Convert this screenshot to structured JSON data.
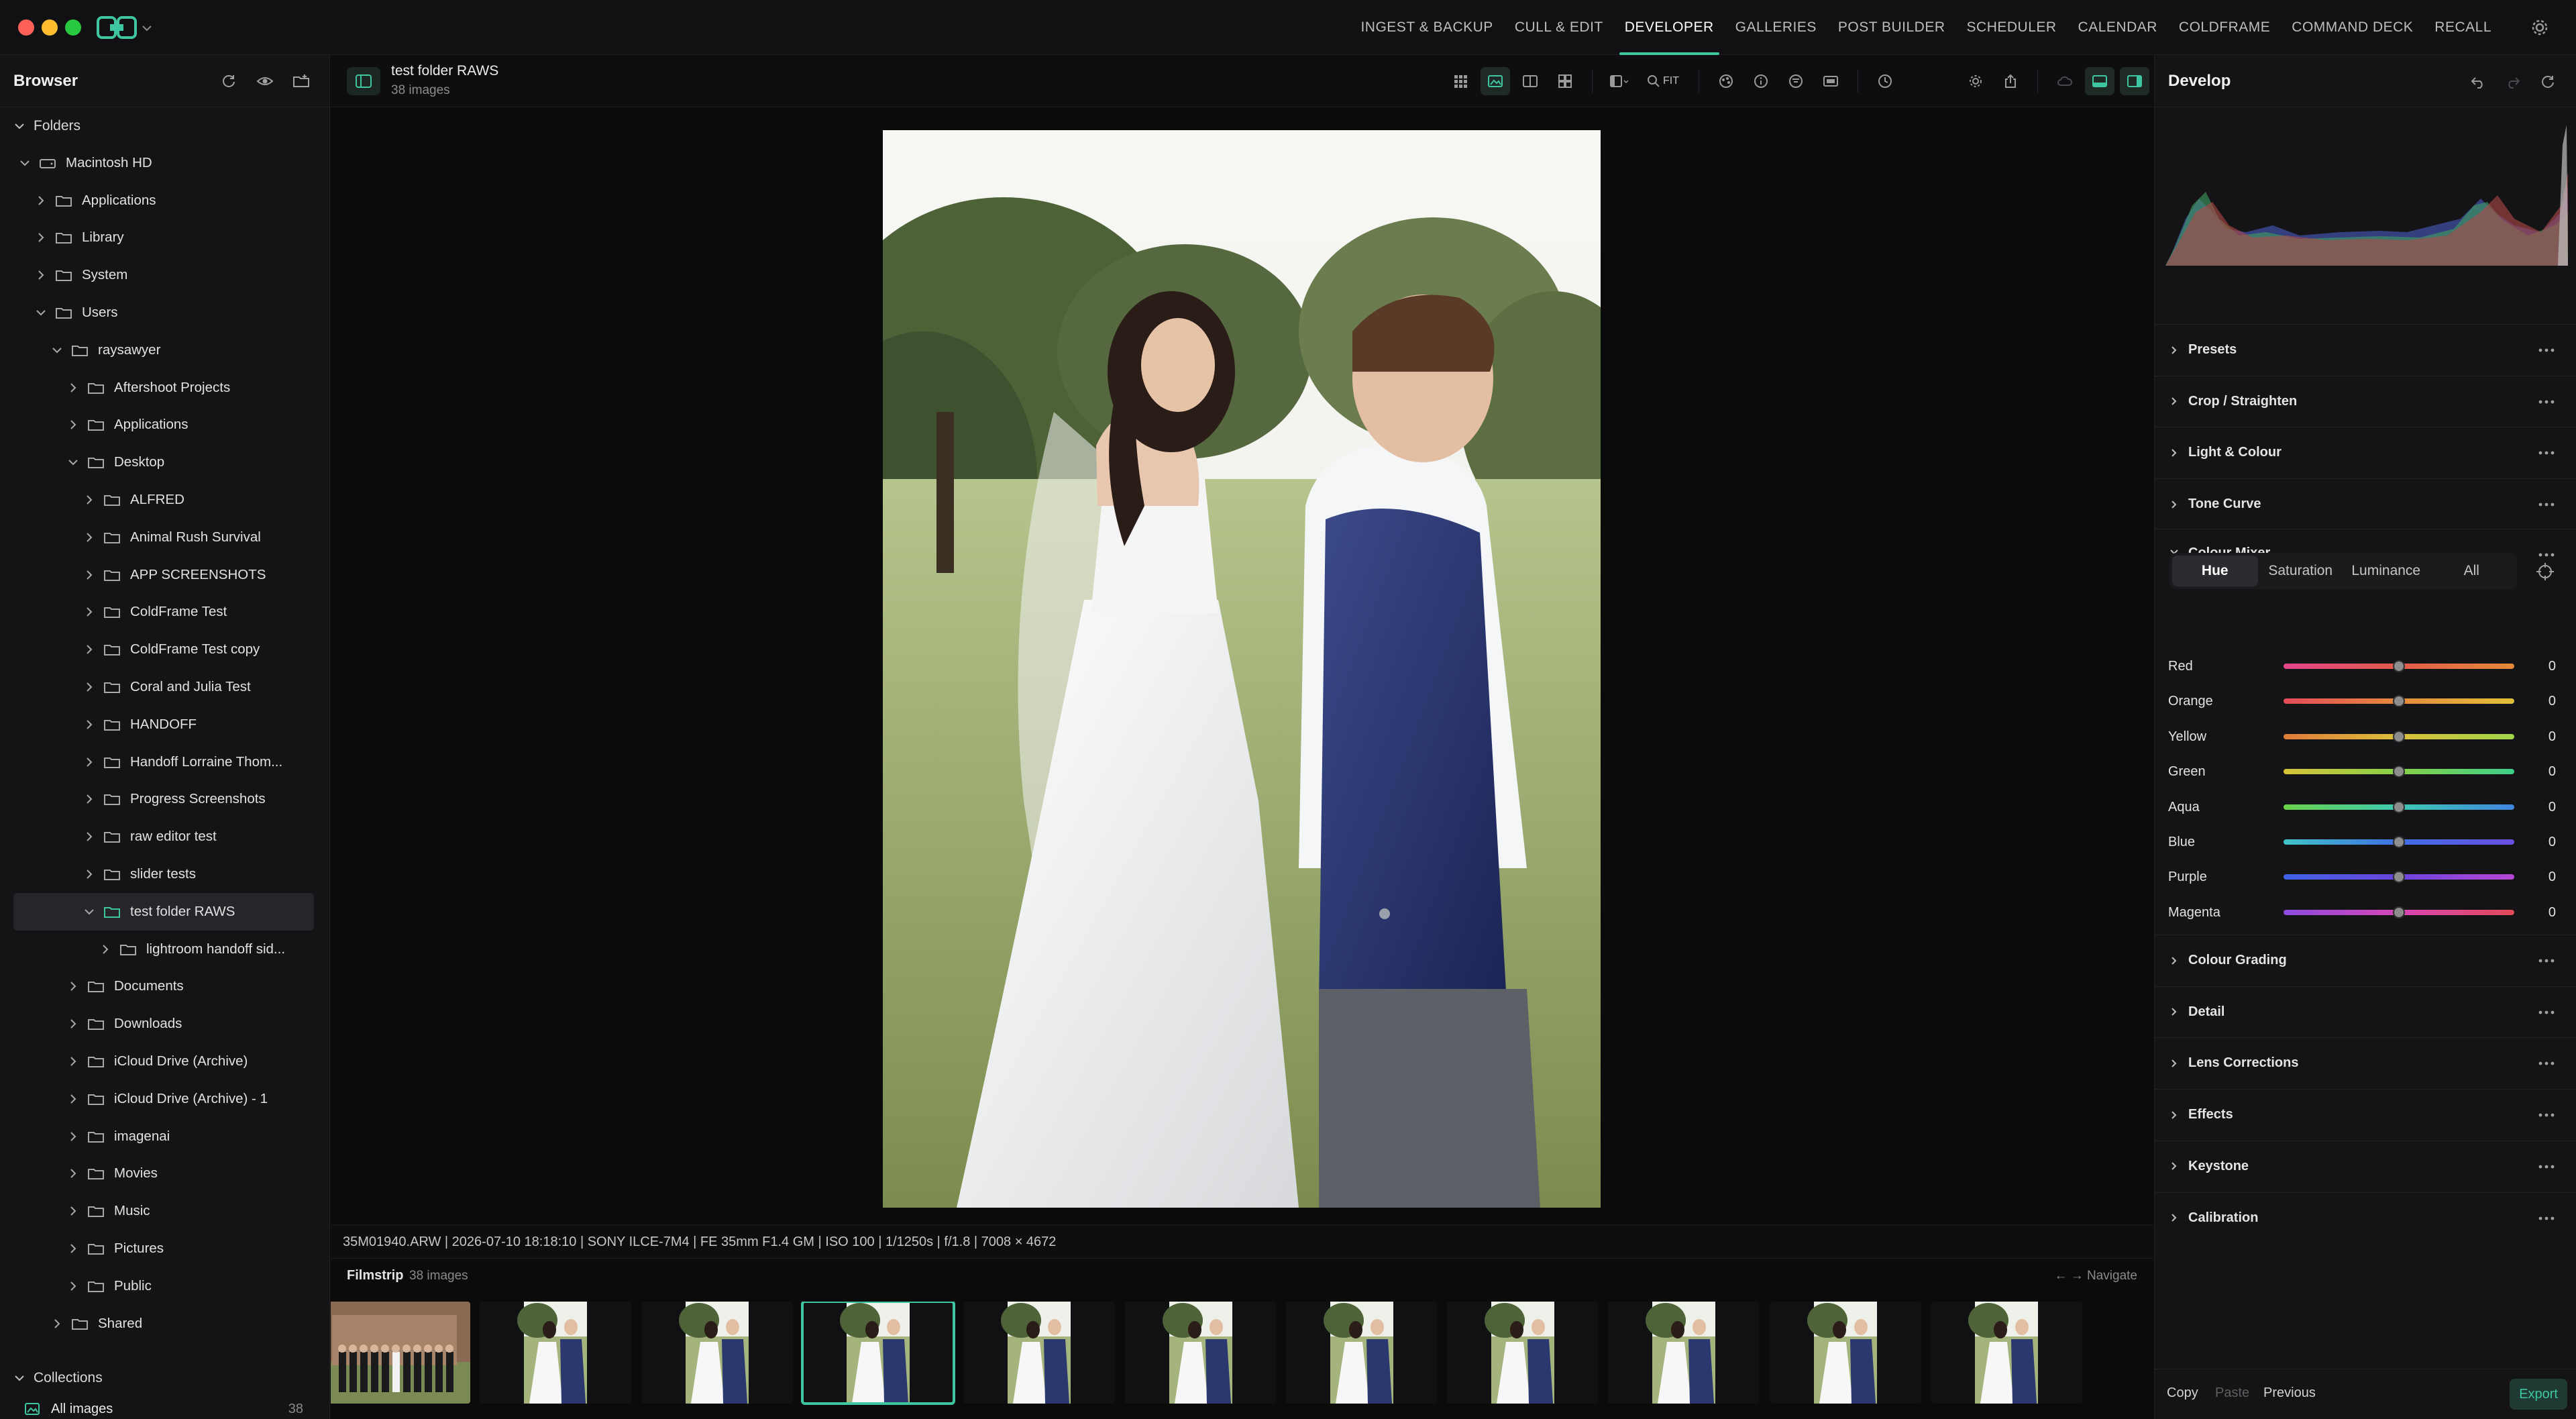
{
  "topbar": {
    "modules": [
      {
        "label": "INGEST & BACKUP",
        "active": false
      },
      {
        "label": "CULL & EDIT",
        "active": false
      },
      {
        "label": "DEVELOPER",
        "active": true
      },
      {
        "label": "GALLERIES",
        "active": false
      },
      {
        "label": "POST BUILDER",
        "active": false
      },
      {
        "label": "SCHEDULER",
        "active": false
      },
      {
        "label": "CALENDAR",
        "active": false
      },
      {
        "label": "COLDFRAME",
        "active": false
      },
      {
        "label": "COMMAND DECK",
        "active": false
      },
      {
        "label": "RECALL",
        "active": false
      }
    ]
  },
  "sidebar": {
    "title": "Browser",
    "folders_label": "Folders",
    "tree": [
      {
        "label": "Macintosh HD",
        "depth": 0,
        "expanded": true,
        "icon": "drive-icon"
      },
      {
        "label": "Applications",
        "depth": 1,
        "expanded": false,
        "icon": "folder-icon"
      },
      {
        "label": "Library",
        "depth": 1,
        "expanded": false,
        "icon": "folder-icon"
      },
      {
        "label": "System",
        "depth": 1,
        "expanded": false,
        "icon": "folder-icon"
      },
      {
        "label": "Users",
        "depth": 1,
        "expanded": true,
        "icon": "folder-icon"
      },
      {
        "label": "raysawyer",
        "depth": 2,
        "expanded": true,
        "icon": "folder-icon"
      },
      {
        "label": "Aftershoot Projects",
        "depth": 3,
        "expanded": false,
        "icon": "folder-icon"
      },
      {
        "label": "Applications",
        "depth": 3,
        "expanded": false,
        "icon": "folder-icon"
      },
      {
        "label": "Desktop",
        "depth": 3,
        "expanded": true,
        "icon": "folder-icon"
      },
      {
        "label": "ALFRED",
        "depth": 4,
        "expanded": false,
        "icon": "folder-icon"
      },
      {
        "label": "Animal Rush Survival",
        "depth": 4,
        "expanded": false,
        "icon": "folder-icon"
      },
      {
        "label": "APP SCREENSHOTS",
        "depth": 4,
        "expanded": false,
        "icon": "folder-icon"
      },
      {
        "label": "ColdFrame Test",
        "depth": 4,
        "expanded": false,
        "icon": "folder-icon"
      },
      {
        "label": "ColdFrame Test copy",
        "depth": 4,
        "expanded": false,
        "icon": "folder-icon"
      },
      {
        "label": "Coral and Julia Test",
        "depth": 4,
        "expanded": false,
        "icon": "folder-icon"
      },
      {
        "label": "HANDOFF",
        "depth": 4,
        "expanded": false,
        "icon": "folder-icon"
      },
      {
        "label": "Handoff Lorraine Thom...",
        "depth": 4,
        "expanded": false,
        "icon": "folder-icon"
      },
      {
        "label": "Progress Screenshots",
        "depth": 4,
        "expanded": false,
        "icon": "folder-icon"
      },
      {
        "label": "raw editor test",
        "depth": 4,
        "expanded": false,
        "icon": "folder-icon"
      },
      {
        "label": "slider tests",
        "depth": 4,
        "expanded": false,
        "icon": "folder-icon"
      },
      {
        "label": "test folder RAWS",
        "depth": 4,
        "expanded": true,
        "icon": "folder-icon",
        "selected": true
      },
      {
        "label": "lightroom handoff sid...",
        "depth": 5,
        "expanded": false,
        "icon": "folder-icon"
      },
      {
        "label": "Documents",
        "depth": 3,
        "expanded": false,
        "icon": "folder-icon"
      },
      {
        "label": "Downloads",
        "depth": 3,
        "expanded": false,
        "icon": "folder-icon"
      },
      {
        "label": "iCloud Drive (Archive)",
        "depth": 3,
        "expanded": false,
        "icon": "folder-icon"
      },
      {
        "label": "iCloud Drive (Archive) - 1",
        "depth": 3,
        "expanded": false,
        "icon": "folder-icon"
      },
      {
        "label": "imagenai",
        "depth": 3,
        "expanded": false,
        "icon": "folder-icon"
      },
      {
        "label": "Movies",
        "depth": 3,
        "expanded": false,
        "icon": "folder-icon"
      },
      {
        "label": "Music",
        "depth": 3,
        "expanded": false,
        "icon": "folder-icon"
      },
      {
        "label": "Pictures",
        "depth": 3,
        "expanded": false,
        "icon": "folder-icon"
      },
      {
        "label": "Public",
        "depth": 3,
        "expanded": false,
        "icon": "folder-icon"
      },
      {
        "label": "Shared",
        "depth": 2,
        "expanded": false,
        "icon": "folder-icon"
      }
    ],
    "collections_label": "Collections",
    "all_images_label": "All images",
    "all_images_count": "38"
  },
  "center": {
    "folder_name": "test folder RAWS",
    "folder_count": "38 images",
    "zoom_label": "FIT",
    "exif": "35M01940.ARW | 2026-07-10 18:18:10 | SONY ILCE-7M4 | FE 35mm F1.4 GM | ISO 100 | 1/1250s | f/1.8 | 7008 × 4672",
    "filmstrip_label": "Filmstrip",
    "filmstrip_count": "38 images",
    "filmstrip_nav": "← → Navigate",
    "thumbnails": [
      {
        "kind": "group"
      },
      {
        "kind": "couple"
      },
      {
        "kind": "couple"
      },
      {
        "kind": "couple",
        "selected": true
      },
      {
        "kind": "couple"
      },
      {
        "kind": "couple"
      },
      {
        "kind": "couple"
      },
      {
        "kind": "couple"
      },
      {
        "kind": "couple"
      },
      {
        "kind": "couple"
      },
      {
        "kind": "couple"
      }
    ]
  },
  "rpanel": {
    "title": "Develop",
    "sections_top": [
      "Presets",
      "Crop / Straighten",
      "Light & Colour",
      "Tone Curve"
    ],
    "colour_mixer_label": "Colour Mixer",
    "cm_tabs": [
      {
        "label": "Hue",
        "active": true
      },
      {
        "label": "Saturation",
        "active": false
      },
      {
        "label": "Luminance",
        "active": false
      },
      {
        "label": "All",
        "active": false
      }
    ],
    "hsl": [
      {
        "label": "Red",
        "value": "0",
        "gradient": "linear-gradient(90deg,#e0458a,#e35b4b,#e48a3a)"
      },
      {
        "label": "Orange",
        "value": "0",
        "gradient": "linear-gradient(90deg,#e34b5a,#e68a3c,#e2c03a)"
      },
      {
        "label": "Yellow",
        "value": "0",
        "gradient": "linear-gradient(90deg,#e07a3b,#dcc03a,#9fd34a)"
      },
      {
        "label": "Green",
        "value": "0",
        "gradient": "linear-gradient(90deg,#d8c33a,#86d147,#3fcf8a)"
      },
      {
        "label": "Aqua",
        "value": "0",
        "gradient": "linear-gradient(90deg,#6ad34a,#3ec9b2,#3f86e0)"
      },
      {
        "label": "Blue",
        "value": "0",
        "gradient": "linear-gradient(90deg,#40c4c8,#3f6fe4,#6a4fe0)"
      },
      {
        "label": "Purple",
        "value": "0",
        "gradient": "linear-gradient(90deg,#3f63e4,#6a45de,#b846d4)"
      },
      {
        "label": "Magenta",
        "value": "0",
        "gradient": "linear-gradient(90deg,#8b4ae0,#d846b6,#e34a58)"
      }
    ],
    "sections_bottom": [
      "Colour Grading",
      "Detail",
      "Lens Corrections",
      "Effects",
      "Keystone",
      "Calibration"
    ],
    "footer": {
      "copy": "Copy",
      "paste": "Paste",
      "previous": "Previous",
      "export": "Export"
    }
  },
  "colors": {
    "accent": "#3ec6a0",
    "bg": "#0b0b0c",
    "panel": "#141416"
  }
}
